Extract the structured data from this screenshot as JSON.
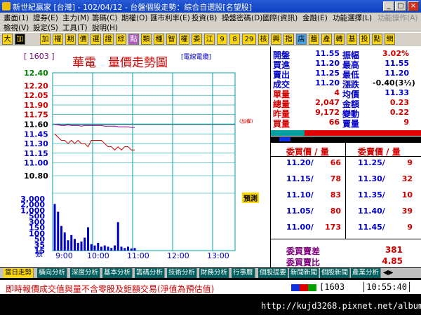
{
  "window": {
    "title": "新世紀贏家 [台灣] - 102/04/12 - 台盤個股走勢：綜合自選股[名望股]",
    "min_label": "_",
    "max_label": "□",
    "close_label": "×"
  },
  "menu1": [
    "畫面(1)",
    "證券(E)",
    "主力(M)",
    "籌碼(C)",
    "期權(O)",
    "匯市利率(E)",
    "投資(B)",
    "操盤密碼(D)",
    "國際(資訊)",
    "金融(E)",
    "功能選擇(L)",
    "功能操作(A)"
  ],
  "menu2": [
    "檢視(V)",
    "設定(S)",
    "工具(T)",
    "說明(H)"
  ],
  "toolbar": [
    "大",
    "加",
    "權",
    "期",
    "價",
    "選",
    "證",
    "綜",
    "點",
    "類",
    "種",
    "智",
    "權",
    "委",
    "江",
    "9",
    "8",
    "29",
    "核",
    "興",
    "指",
    "店",
    "醬",
    "產",
    "轉",
    "基",
    "投",
    "點",
    "網"
  ],
  "chart": {
    "code": "[ 1603 ]",
    "title": "華電　量價走勢圖",
    "mode_label": "[電線電纜]",
    "y_ticks": [
      "12.40",
      "12.20",
      "12.05",
      "11.90",
      "11.75",
      "11.60",
      "11.45",
      "11.30",
      "11.15",
      "11.00",
      "10.80"
    ],
    "y_colors": [
      "#008000",
      "#d00000",
      "#d00000",
      "#d00000",
      "#d00000",
      "#000000",
      "#0000c8",
      "#0000c8",
      "#0000c8",
      "#0000c8",
      "#000000"
    ],
    "prev_close_tag": "(加權)",
    "predict_label": "預測",
    "vol_ticks": [
      "3,000",
      "2,000",
      "1,000",
      "500",
      "300",
      "150",
      "100",
      "50",
      "35",
      "15"
    ],
    "vol_unit": "張",
    "time_labels": [
      "9:00",
      "10:00",
      "11:00",
      "12:00",
      "13:00"
    ]
  },
  "chart_data": {
    "type": "line",
    "title": "華電　量價走勢圖",
    "xlabel": "",
    "ylabel": "",
    "ylim": [
      10.8,
      12.4
    ],
    "x": [
      "9:00",
      "9:05",
      "9:10",
      "9:15",
      "9:20",
      "9:25",
      "9:30",
      "9:35",
      "9:40",
      "9:45",
      "9:50",
      "9:55",
      "10:00",
      "10:05",
      "10:10",
      "10:15",
      "10:20",
      "10:25",
      "10:30",
      "10:35",
      "10:40",
      "10:45",
      "10:50",
      "10:55",
      "11:00"
    ],
    "series": [
      {
        "name": "",
        "values": [
          11.45,
          11.4,
          11.35,
          11.35,
          11.3,
          11.35,
          11.3,
          11.35,
          11.3,
          11.3,
          11.25,
          11.35,
          11.35,
          11.35,
          11.35,
          11.3,
          11.25,
          11.25,
          11.2,
          11.25,
          11.2,
          11.25,
          11.25,
          11.2,
          11.2
        ]
      },
      {
        "name": "",
        "values": [
          11.6,
          11.59,
          11.58,
          11.58,
          11.59,
          11.58,
          11.58,
          11.58,
          11.57,
          11.58,
          11.58,
          11.58,
          11.58,
          11.58,
          11.58,
          11.57,
          11.57,
          11.57,
          11.57,
          11.56,
          11.56,
          11.56,
          11.56,
          11.55,
          11.55
        ]
      }
    ],
    "volume": [
      180,
      150,
      95,
      70,
      40,
      60,
      45,
      30,
      35,
      50,
      90,
      25,
      20,
      30,
      15,
      20,
      15,
      10,
      20,
      110,
      15,
      10,
      15,
      8,
      10
    ],
    "ref_price": 11.6,
    "grid": true
  },
  "quote": {
    "rows": [
      {
        "l1": "開盤",
        "v1": "11.55",
        "l2": "振幅",
        "v2": "3.02%",
        "c1": "#0000c8",
        "c2": "#d00000"
      },
      {
        "l1": "買進",
        "v1": "11.20",
        "l2": "最高",
        "v2": "11.55",
        "c1": "#0000c8",
        "c2": "#0000c8"
      },
      {
        "l1": "賣出",
        "v1": "11.25",
        "l2": "最低",
        "v2": "11.20",
        "c1": "#0000c8",
        "c2": "#0000c8"
      },
      {
        "l1": "成交",
        "v1": "11.20",
        "l2": "漲跌",
        "v2": "-0.40(3½)",
        "c1": "#0000c8",
        "c2": "#000000"
      },
      {
        "l1": "單量",
        "v1": "4",
        "l2": "均價",
        "v2": "11.33",
        "c1": "#d00000",
        "c2": "#0000c8"
      },
      {
        "l1": "總量",
        "v1": "2,047",
        "l2": "金額",
        "v2": "0.23",
        "c1": "#d00000",
        "c2": "#d00000"
      },
      {
        "l1": "昨量",
        "v1": "9,172",
        "l2": "變動",
        "v2": "0.22",
        "c1": "#d00000",
        "c2": "#d00000"
      },
      {
        "l1": "買量",
        "v1": "66",
        "l2": "賣量",
        "v2": "9",
        "c1": "#d00000",
        "c2": "#d00000"
      }
    ]
  },
  "book": {
    "buy_header": "委買價 / 量",
    "sell_header": "委賣價 / 量",
    "buys": [
      {
        "price": "11.20",
        "qty": "66"
      },
      {
        "price": "11.15",
        "qty": "78"
      },
      {
        "price": "11.10",
        "qty": "83"
      },
      {
        "price": "11.05",
        "qty": "80"
      },
      {
        "price": "11.00",
        "qty": "173"
      }
    ],
    "sells": [
      {
        "price": "11.25",
        "qty": "9"
      },
      {
        "price": "11.30",
        "qty": "32"
      },
      {
        "price": "11.35",
        "qty": "10"
      },
      {
        "price": "11.40",
        "qty": "39"
      },
      {
        "price": "11.45",
        "qty": "9"
      }
    ],
    "diff_label": "委買賣差",
    "diff_value": "381",
    "ratio_label": "委買賣比",
    "ratio_value": "4.85"
  },
  "tabs": [
    "當日走勢",
    "橫向分析",
    "深度分析",
    "基本分析",
    "籌碼分析",
    "技術分析",
    "財務分析",
    "行事曆",
    "個股提要",
    "新聞新聞",
    "個股新聞",
    "產業分析"
  ],
  "status": {
    "message": "即時報價成交值與量不含零股及鉅額交易(淨值為預估值)",
    "code": "1603",
    "time": "10:55:40"
  },
  "watermark": "http://kujd3268.pixnet.net/album"
}
